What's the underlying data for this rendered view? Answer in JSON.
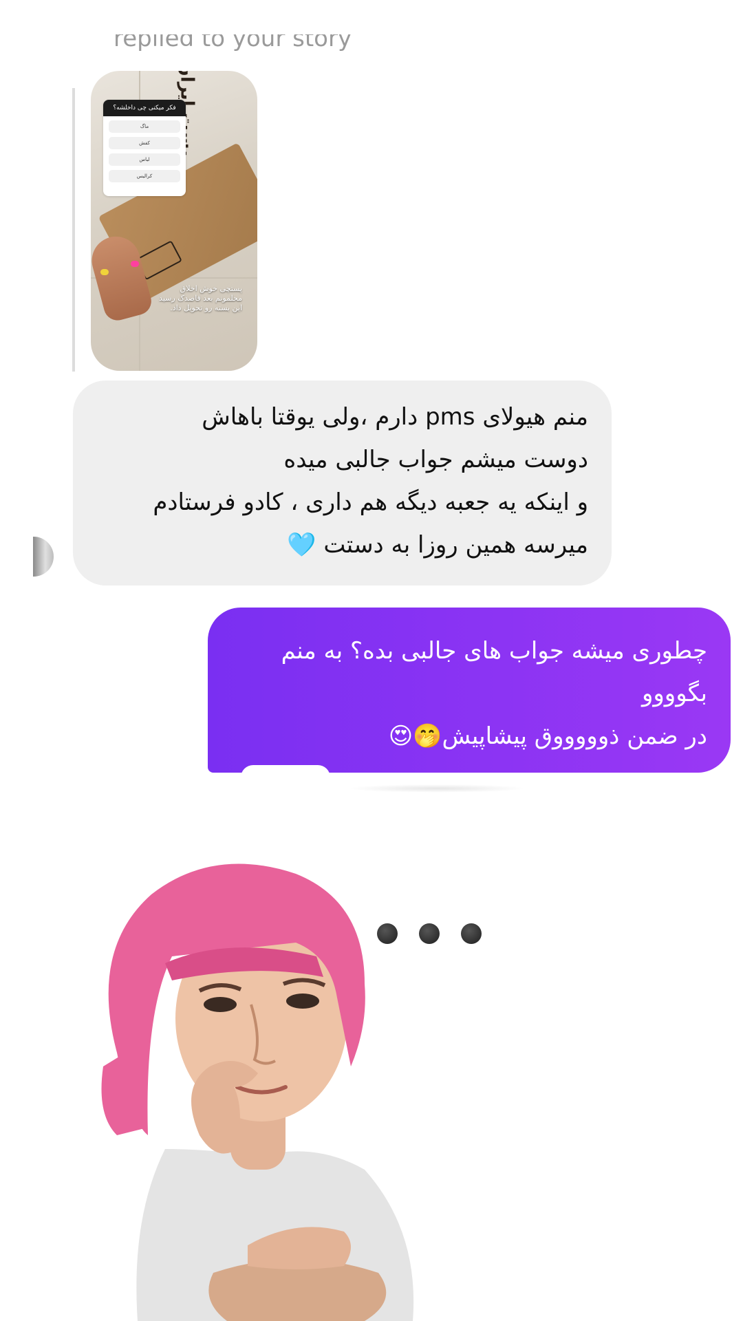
{
  "story": {
    "caption": "replied to your story",
    "poll_question": "فکر میکنی چی داخلشه؟",
    "poll_options": [
      "ماگ",
      "کفش",
      "لباس",
      "کرالیس"
    ],
    "box_text": "پست ایران",
    "note": "پستچی خوش اخلاق محلمونم بعد قاصدک رسید این بسته رو تحویل داد."
  },
  "messages": [
    {
      "direction": "incoming",
      "lines": [
        "منم هیولای pms دارم ،ولی یوقتا باهاش",
        "دوست میشم جواب جالبی میده",
        "و اینکه یه جعبه دیگه هم داری ، کادو فرستادم",
        "میرسه همین روزا به دستت 🩵"
      ]
    },
    {
      "direction": "outgoing",
      "lines": [
        "چطوری میشه جواب های جالبی بده؟ به منم",
        "بگوووو",
        "در ضمن ذوووووق پیشاپیش🤭😍"
      ]
    }
  ],
  "colors": {
    "incoming_bubble": "#efefef",
    "outgoing_bubble_start": "#7a2ff2",
    "outgoing_bubble_end": "#9a38f4",
    "hair": "#e8629a"
  }
}
